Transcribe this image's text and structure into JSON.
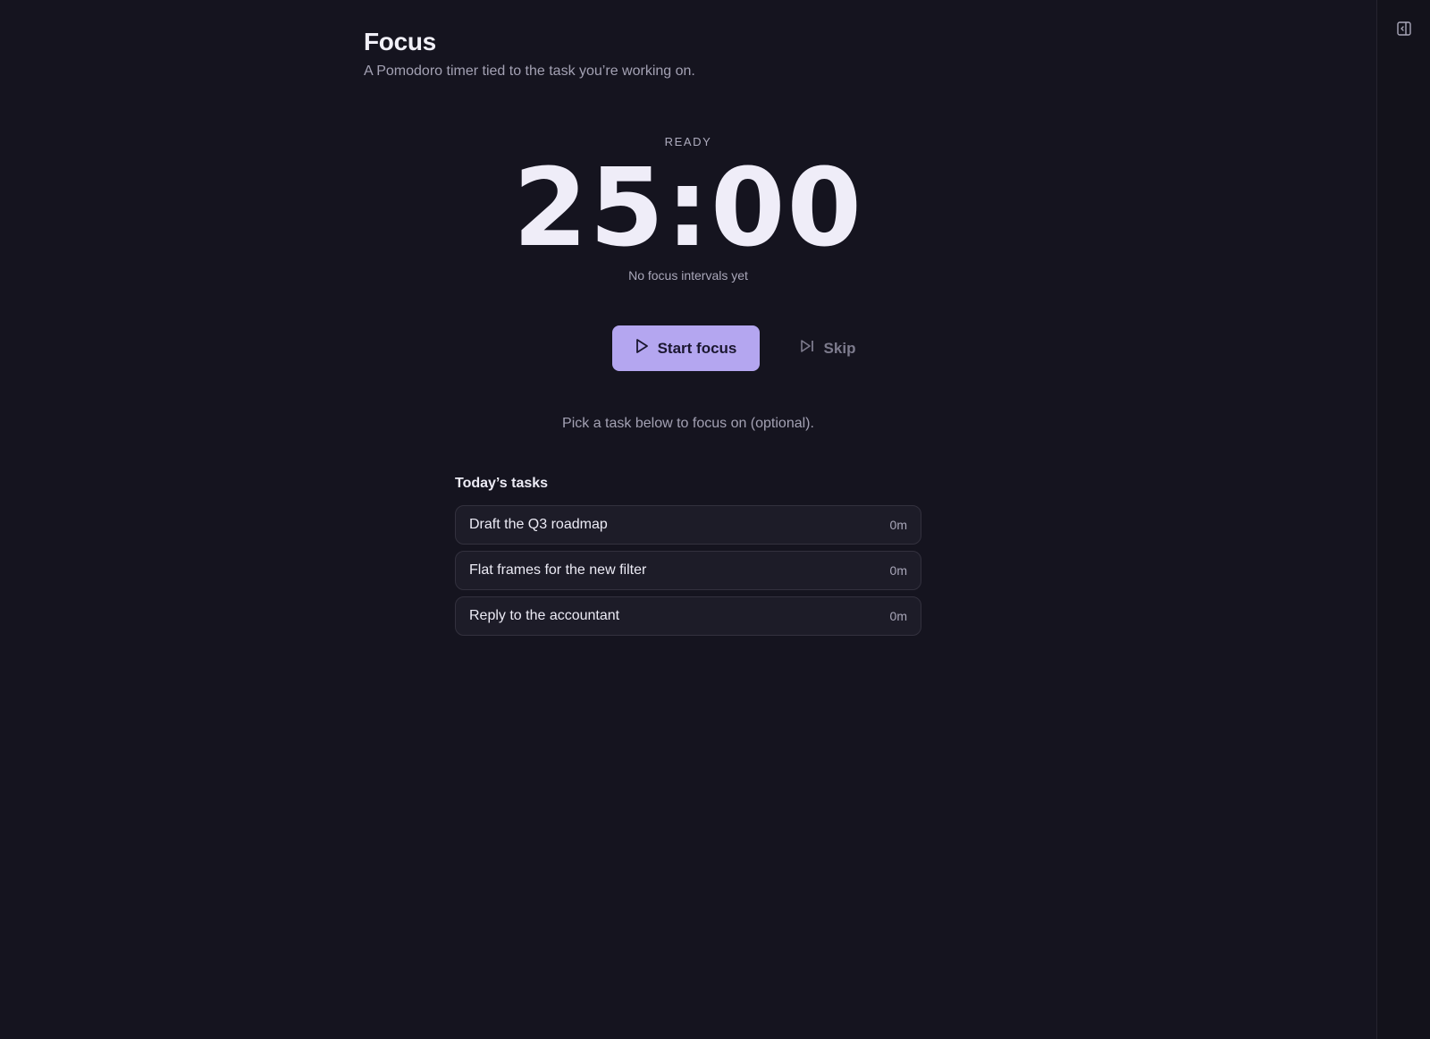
{
  "page": {
    "title": "Focus",
    "subtitle": "A Pomodoro timer tied to the task you’re working on."
  },
  "timer": {
    "status": "READY",
    "display": "25:00",
    "sub": "No focus intervals yet"
  },
  "controls": {
    "start_label": "Start focus",
    "skip_label": "Skip"
  },
  "hint": "Pick a task below to focus on (optional).",
  "tasks": {
    "heading": "Today’s tasks",
    "items": [
      {
        "title": "Draft the Q3 roadmap",
        "time": "0m"
      },
      {
        "title": "Flat frames for the new filter",
        "time": "0m"
      },
      {
        "title": "Reply to the accountant",
        "time": "0m"
      }
    ]
  },
  "colors": {
    "background": "#15141f",
    "accent": "#b4a6f0",
    "card": "#1d1c28",
    "muted_text": "#a3a1b3"
  },
  "icons": {
    "rail_toggle": "sidebar-toggle-icon",
    "start": "play-icon",
    "skip": "skip-forward-icon"
  }
}
